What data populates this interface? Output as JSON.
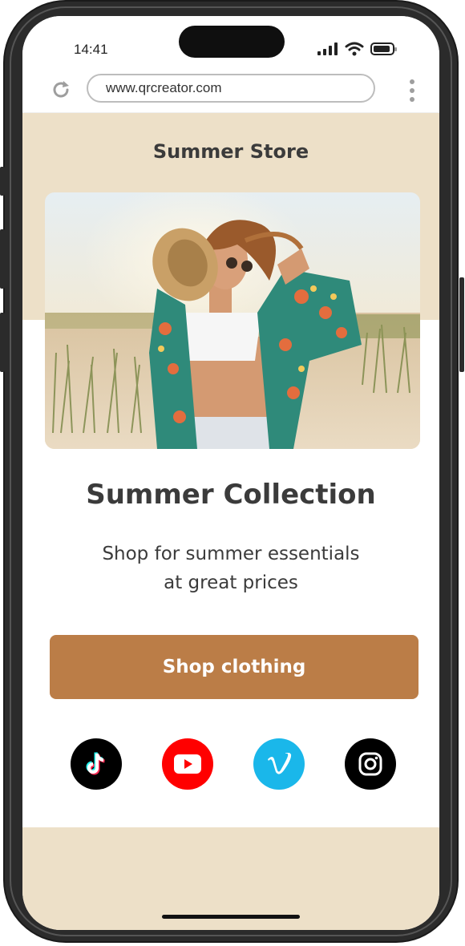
{
  "status_bar": {
    "time": "14:41"
  },
  "browser": {
    "url": "www.qrcreator.com"
  },
  "page": {
    "store_title": "Summer Store",
    "collection_title": "Summer Collection",
    "description_line1": "Shop for summer essentials",
    "description_line2": "at great prices",
    "cta_label": "Shop clothing"
  },
  "social_links": [
    {
      "name": "tiktok-icon",
      "color": "#000000"
    },
    {
      "name": "youtube-icon",
      "color": "#ff0000"
    },
    {
      "name": "vimeo-icon",
      "color": "#1ab7ea"
    },
    {
      "name": "instagram-icon",
      "color": "#000000"
    }
  ],
  "colors": {
    "page_background": "#ede0c8",
    "cta": "#bb7d47",
    "text": "#3b3b3b"
  }
}
